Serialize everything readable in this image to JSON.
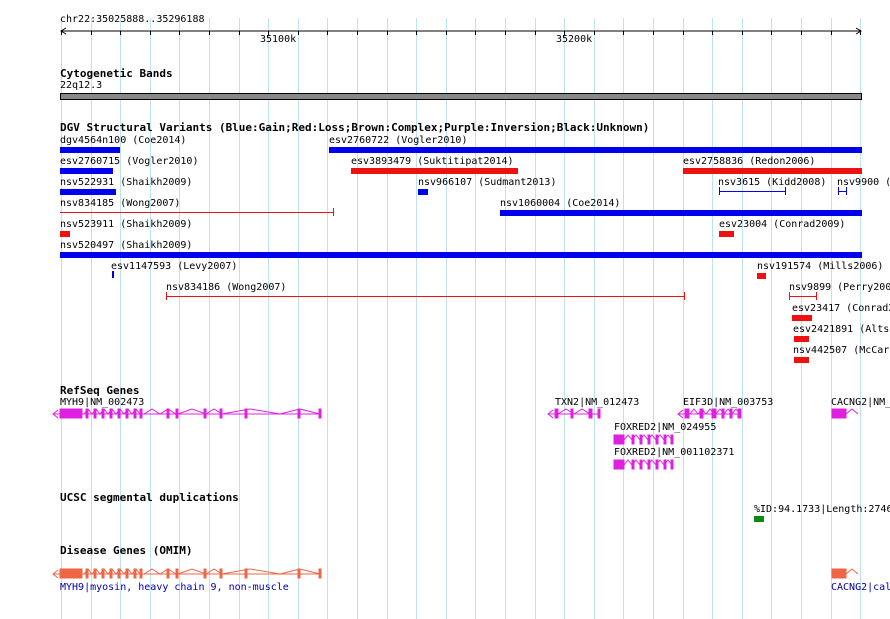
{
  "ruler": {
    "location": "chr22:35025888..35296188",
    "tick_labels": [
      "35100k",
      "35200k"
    ]
  },
  "tracks": {
    "cytoband": {
      "title": "Cytogenetic Bands",
      "band_label": "22q12.3"
    },
    "dgv": {
      "title": "DGV Structural Variants (Blue:Gain;Red:Loss;Brown:Complex;Purple:Inversion;Black:Unknown)",
      "labels": [
        "dgv4564n100 (Coe2014)",
        "esv2760722 (Vogler2010)",
        "esv2760715 (Vogler2010)",
        "esv3893479 (Suktitipat2014)",
        "esv2758836 (Redon2006)",
        "nsv522931 (Shaikh2009)",
        "nsv966107 (Sudmant2013)",
        "nsv3615 (Kidd2008)",
        "nsv9900 (",
        "nsv834185 (Wong2007)",
        "nsv1060004 (Coe2014)",
        "nsv523911 (Shaikh2009)",
        "esv23004 (Conrad2009)",
        "nsv520497 (Shaikh2009)",
        "esv1147593 (Levy2007)",
        "nsv191574 (Mills2006)",
        "nsv834186 (Wong2007)",
        "nsv9899 (Perry200",
        "esv23417 (Conrad2",
        "esv2421891 (Alts",
        "nsv442507 (McCar"
      ]
    },
    "refseq": {
      "title": "RefSeq Genes",
      "labels": [
        "MYH9|NM_002473",
        "TXN2|NM_012473",
        "EIF3D|NM_003753",
        "CACNG2|NM_",
        "FOXRED2|NM_024955",
        "FOXRED2|NM_001102371"
      ]
    },
    "segdup": {
      "title": "UCSC segmental duplications",
      "label": "%ID:94.1733|Length:2746"
    },
    "omim": {
      "title": "Disease Genes (OMIM)",
      "labels": [
        "MYH9|myosin, heavy chain 9, non-muscle",
        "CACNG2|cal"
      ]
    }
  },
  "colors": {
    "gain": "#0000ee",
    "loss": "#ee1111",
    "refseq": "#e020e0",
    "omim": "#ee6644",
    "segdup": "#118811",
    "grid": "#bfe3ee",
    "cytoband": "#888888"
  }
}
